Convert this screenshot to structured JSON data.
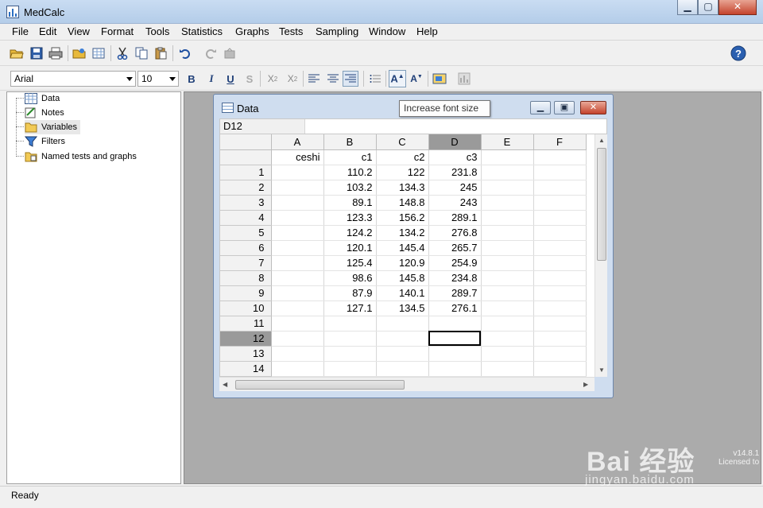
{
  "app": {
    "title": "MedCalc"
  },
  "menu": [
    "File",
    "Edit",
    "View",
    "Format",
    "Tools",
    "Statistics",
    "Graphs",
    "Tests",
    "Sampling",
    "Window",
    "Help"
  ],
  "format_bar": {
    "font": "Arial",
    "size": "10",
    "bold": "B",
    "italic": "I",
    "underline": "U",
    "strike": "S"
  },
  "tree": [
    {
      "label": "Data",
      "icon": "table-icon"
    },
    {
      "label": "Notes",
      "icon": "notes-icon"
    },
    {
      "label": "Variables",
      "icon": "folder-icon"
    },
    {
      "label": "Filters",
      "icon": "filter-icon"
    },
    {
      "label": "Named tests and graphs",
      "icon": "folder-icon"
    }
  ],
  "data_window": {
    "title": "Data",
    "tooltip": "Increase font size",
    "cell_ref": "D12",
    "columns": [
      "A",
      "B",
      "C",
      "D",
      "E",
      "F"
    ],
    "selected_column": "D",
    "header_row": [
      "ceshi",
      "c1",
      "c2",
      "c3",
      "",
      ""
    ],
    "rows": [
      [
        "1",
        "",
        "110.2",
        "122",
        "231.8",
        "",
        ""
      ],
      [
        "2",
        "",
        "103.2",
        "134.3",
        "245",
        "",
        ""
      ],
      [
        "3",
        "",
        "89.1",
        "148.8",
        "243",
        "",
        ""
      ],
      [
        "4",
        "",
        "123.3",
        "156.2",
        "289.1",
        "",
        ""
      ],
      [
        "5",
        "",
        "124.2",
        "134.2",
        "276.8",
        "",
        ""
      ],
      [
        "6",
        "",
        "120.1",
        "145.4",
        "265.7",
        "",
        ""
      ],
      [
        "7",
        "",
        "125.4",
        "120.9",
        "254.9",
        "",
        ""
      ],
      [
        "8",
        "",
        "98.6",
        "145.8",
        "234.8",
        "",
        ""
      ],
      [
        "9",
        "",
        "87.9",
        "140.1",
        "289.7",
        "",
        ""
      ],
      [
        "10",
        "",
        "127.1",
        "134.5",
        "276.1",
        "",
        ""
      ],
      [
        "11",
        "",
        "",
        "",
        "",
        "",
        ""
      ],
      [
        "12",
        "",
        "",
        "",
        "",
        "",
        ""
      ],
      [
        "13",
        "",
        "",
        "",
        "",
        "",
        ""
      ],
      [
        "14",
        "",
        "",
        "",
        "",
        "",
        ""
      ]
    ],
    "selected_row": "12"
  },
  "status": {
    "text": "Ready"
  },
  "watermark": {
    "brand": "Bai 经验",
    "url": "jingyan.baidu.com",
    "version": "v14.8.1",
    "licensed": "Licensed to"
  }
}
